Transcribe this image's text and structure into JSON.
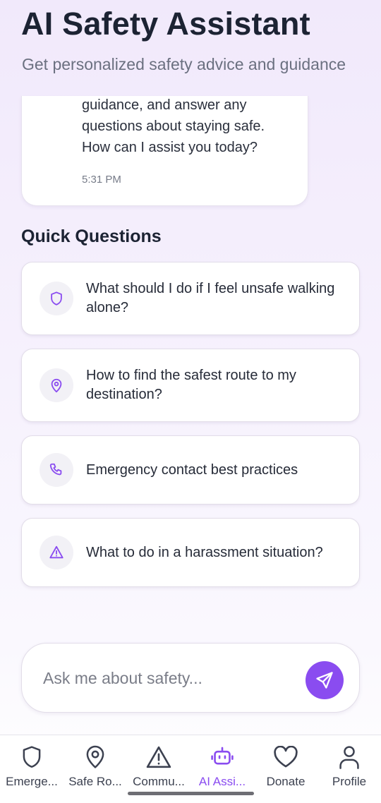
{
  "header": {
    "title": "AI Safety Assistant",
    "subtitle": "Get personalized safety advice and guidance"
  },
  "chat": {
    "message": "guidance, and answer any\nquestions about staying safe.\nHow can I assist you today?",
    "time": "5:31 PM"
  },
  "quick_questions": {
    "title": "Quick Questions",
    "items": [
      {
        "icon": "shield-icon",
        "text": "What should I do if I feel unsafe walking alone?"
      },
      {
        "icon": "map-pin-icon",
        "text": "How to find the safest route to my destination?"
      },
      {
        "icon": "phone-icon",
        "text": "Emergency contact best practices"
      },
      {
        "icon": "warning-triangle-icon",
        "text": "What to do in a harassment situation?"
      }
    ]
  },
  "input": {
    "placeholder": "Ask me about safety...",
    "value": ""
  },
  "nav": {
    "items": [
      {
        "label": "Emerge...",
        "icon": "shield-icon",
        "active": false
      },
      {
        "label": "Safe Ro...",
        "icon": "map-pin-icon",
        "active": false
      },
      {
        "label": "Commu...",
        "icon": "warning-triangle-icon",
        "active": false
      },
      {
        "label": "AI Assi...",
        "icon": "robot-icon",
        "active": true
      },
      {
        "label": "Donate",
        "icon": "heart-icon",
        "active": false
      },
      {
        "label": "Profile",
        "icon": "user-icon",
        "active": false
      }
    ]
  },
  "colors": {
    "accent": "#8a4cf0",
    "text_dark": "#1c2333",
    "text_muted": "#6b7080"
  }
}
